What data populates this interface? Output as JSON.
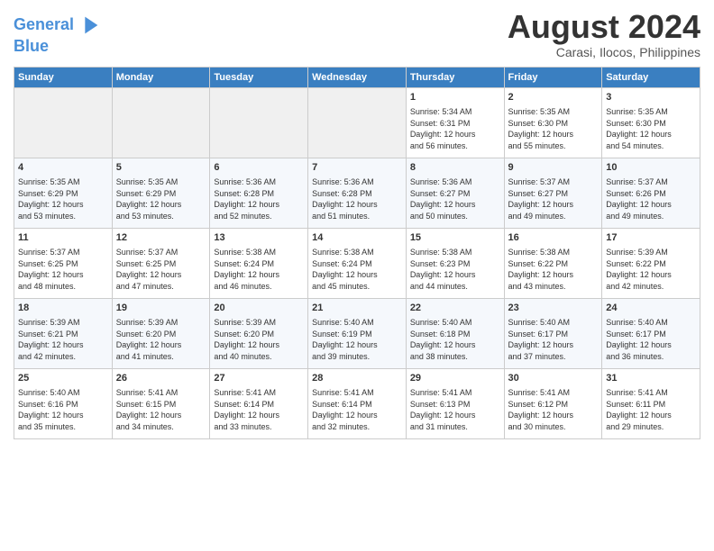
{
  "header": {
    "logo_line1": "General",
    "logo_line2": "Blue",
    "title": "August 2024",
    "subtitle": "Carasi, Ilocos, Philippines"
  },
  "days_of_week": [
    "Sunday",
    "Monday",
    "Tuesday",
    "Wednesday",
    "Thursday",
    "Friday",
    "Saturday"
  ],
  "weeks": [
    [
      {
        "day": "",
        "info": ""
      },
      {
        "day": "",
        "info": ""
      },
      {
        "day": "",
        "info": ""
      },
      {
        "day": "",
        "info": ""
      },
      {
        "day": "1",
        "info": "Sunrise: 5:34 AM\nSunset: 6:31 PM\nDaylight: 12 hours\nand 56 minutes."
      },
      {
        "day": "2",
        "info": "Sunrise: 5:35 AM\nSunset: 6:30 PM\nDaylight: 12 hours\nand 55 minutes."
      },
      {
        "day": "3",
        "info": "Sunrise: 5:35 AM\nSunset: 6:30 PM\nDaylight: 12 hours\nand 54 minutes."
      }
    ],
    [
      {
        "day": "4",
        "info": "Sunrise: 5:35 AM\nSunset: 6:29 PM\nDaylight: 12 hours\nand 53 minutes."
      },
      {
        "day": "5",
        "info": "Sunrise: 5:35 AM\nSunset: 6:29 PM\nDaylight: 12 hours\nand 53 minutes."
      },
      {
        "day": "6",
        "info": "Sunrise: 5:36 AM\nSunset: 6:28 PM\nDaylight: 12 hours\nand 52 minutes."
      },
      {
        "day": "7",
        "info": "Sunrise: 5:36 AM\nSunset: 6:28 PM\nDaylight: 12 hours\nand 51 minutes."
      },
      {
        "day": "8",
        "info": "Sunrise: 5:36 AM\nSunset: 6:27 PM\nDaylight: 12 hours\nand 50 minutes."
      },
      {
        "day": "9",
        "info": "Sunrise: 5:37 AM\nSunset: 6:27 PM\nDaylight: 12 hours\nand 49 minutes."
      },
      {
        "day": "10",
        "info": "Sunrise: 5:37 AM\nSunset: 6:26 PM\nDaylight: 12 hours\nand 49 minutes."
      }
    ],
    [
      {
        "day": "11",
        "info": "Sunrise: 5:37 AM\nSunset: 6:25 PM\nDaylight: 12 hours\nand 48 minutes."
      },
      {
        "day": "12",
        "info": "Sunrise: 5:37 AM\nSunset: 6:25 PM\nDaylight: 12 hours\nand 47 minutes."
      },
      {
        "day": "13",
        "info": "Sunrise: 5:38 AM\nSunset: 6:24 PM\nDaylight: 12 hours\nand 46 minutes."
      },
      {
        "day": "14",
        "info": "Sunrise: 5:38 AM\nSunset: 6:24 PM\nDaylight: 12 hours\nand 45 minutes."
      },
      {
        "day": "15",
        "info": "Sunrise: 5:38 AM\nSunset: 6:23 PM\nDaylight: 12 hours\nand 44 minutes."
      },
      {
        "day": "16",
        "info": "Sunrise: 5:38 AM\nSunset: 6:22 PM\nDaylight: 12 hours\nand 43 minutes."
      },
      {
        "day": "17",
        "info": "Sunrise: 5:39 AM\nSunset: 6:22 PM\nDaylight: 12 hours\nand 42 minutes."
      }
    ],
    [
      {
        "day": "18",
        "info": "Sunrise: 5:39 AM\nSunset: 6:21 PM\nDaylight: 12 hours\nand 42 minutes."
      },
      {
        "day": "19",
        "info": "Sunrise: 5:39 AM\nSunset: 6:20 PM\nDaylight: 12 hours\nand 41 minutes."
      },
      {
        "day": "20",
        "info": "Sunrise: 5:39 AM\nSunset: 6:20 PM\nDaylight: 12 hours\nand 40 minutes."
      },
      {
        "day": "21",
        "info": "Sunrise: 5:40 AM\nSunset: 6:19 PM\nDaylight: 12 hours\nand 39 minutes."
      },
      {
        "day": "22",
        "info": "Sunrise: 5:40 AM\nSunset: 6:18 PM\nDaylight: 12 hours\nand 38 minutes."
      },
      {
        "day": "23",
        "info": "Sunrise: 5:40 AM\nSunset: 6:17 PM\nDaylight: 12 hours\nand 37 minutes."
      },
      {
        "day": "24",
        "info": "Sunrise: 5:40 AM\nSunset: 6:17 PM\nDaylight: 12 hours\nand 36 minutes."
      }
    ],
    [
      {
        "day": "25",
        "info": "Sunrise: 5:40 AM\nSunset: 6:16 PM\nDaylight: 12 hours\nand 35 minutes."
      },
      {
        "day": "26",
        "info": "Sunrise: 5:41 AM\nSunset: 6:15 PM\nDaylight: 12 hours\nand 34 minutes."
      },
      {
        "day": "27",
        "info": "Sunrise: 5:41 AM\nSunset: 6:14 PM\nDaylight: 12 hours\nand 33 minutes."
      },
      {
        "day": "28",
        "info": "Sunrise: 5:41 AM\nSunset: 6:14 PM\nDaylight: 12 hours\nand 32 minutes."
      },
      {
        "day": "29",
        "info": "Sunrise: 5:41 AM\nSunset: 6:13 PM\nDaylight: 12 hours\nand 31 minutes."
      },
      {
        "day": "30",
        "info": "Sunrise: 5:41 AM\nSunset: 6:12 PM\nDaylight: 12 hours\nand 30 minutes."
      },
      {
        "day": "31",
        "info": "Sunrise: 5:41 AM\nSunset: 6:11 PM\nDaylight: 12 hours\nand 29 minutes."
      }
    ]
  ]
}
